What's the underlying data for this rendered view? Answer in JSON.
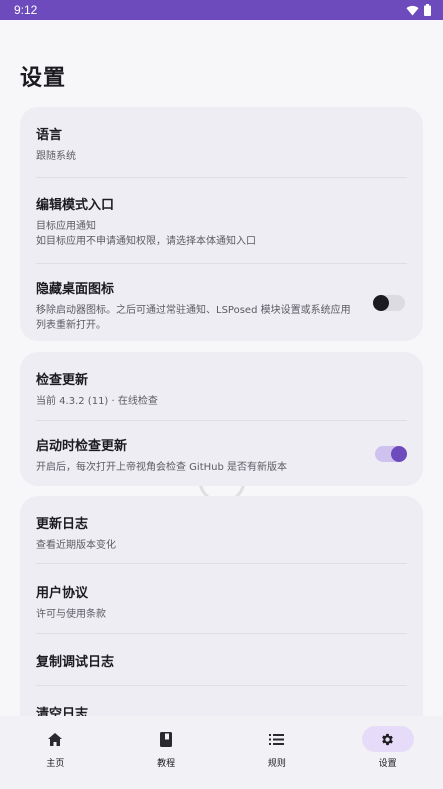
{
  "status_bar": {
    "time": "9:12",
    "icons": [
      "wifi-icon",
      "battery-icon"
    ]
  },
  "page": {
    "title": "设置"
  },
  "group1": {
    "language": {
      "title": "语言",
      "value": "跟随系统"
    },
    "edit_mode": {
      "title": "编辑模式入口",
      "sub1": "目标应用通知",
      "sub2": "如目标应用不申请通知权限，请选择本体通知入口"
    },
    "hide_icon": {
      "title": "隐藏桌面图标",
      "sub": "移除启动器图标。之后可通过常驻通知、LSPosed 模块设置或系统应用列表重新打开。",
      "enabled": false
    }
  },
  "group2": {
    "check_update": {
      "title": "检查更新",
      "sub": "当前 4.3.2 (11) · 在线检查"
    },
    "check_on_start": {
      "title": "启动时检查更新",
      "sub": "开启后，每次打开上帝视角会检查 GitHub 是否有新版本",
      "enabled": true
    }
  },
  "group3": {
    "changelog": {
      "title": "更新日志",
      "sub": "查看近期版本变化"
    },
    "agreement": {
      "title": "用户协议",
      "sub": "许可与使用条款"
    },
    "copy_log": {
      "title": "复制调试日志"
    },
    "clear_log": {
      "title": "清空日志"
    }
  },
  "navbar": {
    "items": [
      {
        "label": "主页",
        "icon": "home-icon"
      },
      {
        "label": "教程",
        "icon": "book-icon"
      },
      {
        "label": "规则",
        "icon": "list-icon"
      },
      {
        "label": "设置",
        "icon": "gear-icon",
        "active": true
      }
    ]
  },
  "colors": {
    "accent": "#6e4bbd",
    "card": "#eeedf3",
    "background": "#f7f6f9",
    "nav_active": "#e6dcfa"
  }
}
